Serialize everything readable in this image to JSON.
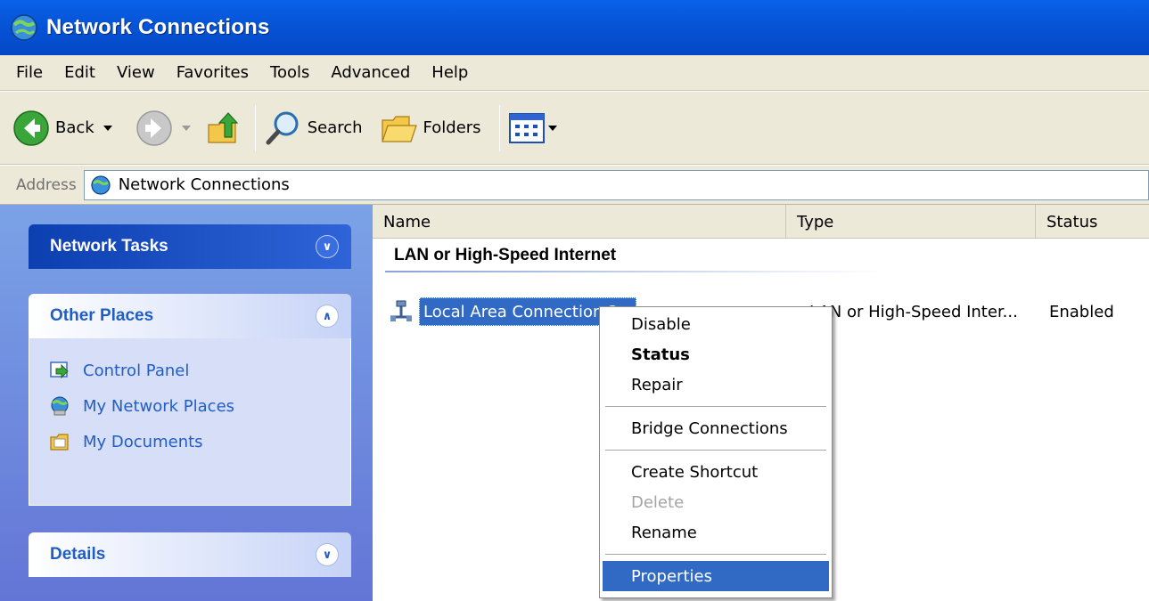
{
  "window": {
    "title": "Network Connections"
  },
  "menu": [
    "File",
    "Edit",
    "View",
    "Favorites",
    "Tools",
    "Advanced",
    "Help"
  ],
  "toolbar": {
    "back_label": "Back",
    "search_label": "Search",
    "folders_label": "Folders"
  },
  "address": {
    "label": "Address",
    "value": "Network Connections"
  },
  "sidebar": {
    "network_tasks": {
      "title": "Network Tasks"
    },
    "other_places": {
      "title": "Other Places",
      "items": [
        "Control Panel",
        "My Network Places",
        "My Documents"
      ]
    },
    "details": {
      "title": "Details"
    }
  },
  "list": {
    "columns": [
      "Name",
      "Type",
      "Status"
    ],
    "group": "LAN or High-Speed Internet",
    "rows": [
      {
        "name": "Local Area Connection 2",
        "type": "LAN or High-Speed Inter...",
        "status": "Enabled"
      }
    ]
  },
  "context_menu": {
    "items": [
      "Disable",
      "Status",
      "Repair",
      "Bridge Connections",
      "Create Shortcut",
      "Delete",
      "Rename",
      "Properties"
    ],
    "bold_item": "Status",
    "disabled_item": "Delete",
    "highlighted_item": "Properties"
  },
  "colors": {
    "title_bar": "#0655d8",
    "selection": "#316ac5",
    "link": "#215dc6",
    "chrome": "#ece9d8"
  }
}
